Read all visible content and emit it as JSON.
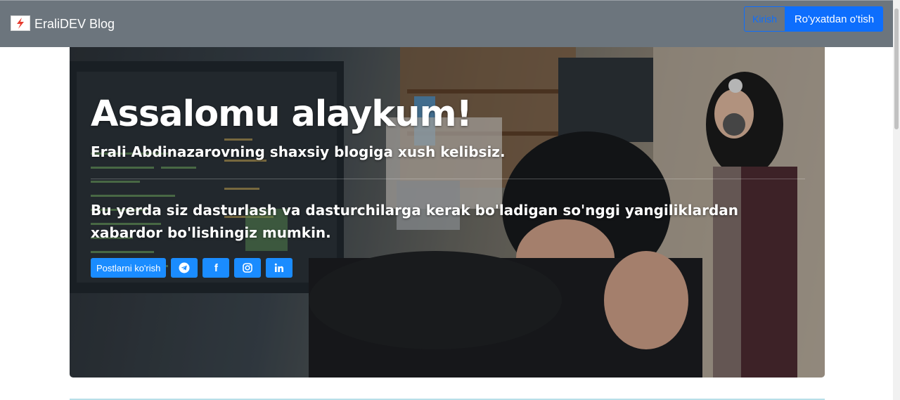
{
  "navbar": {
    "brand_text": "EraliDEV Blog",
    "login_label": "Kirish",
    "register_label": "Ro'yxatdan o'tish"
  },
  "hero": {
    "title": "Assalomu alaykum!",
    "subtitle": "Erali Abdinazarovning shaxsiy blogiga xush kelibsiz.",
    "description": "Bu yerda siz dasturlash va dasturchilarga kerak bo'ladigan so'nggi yangiliklardan xabardor bo'lishingiz mumkin.",
    "posts_button": "Postlarni ko'rish",
    "social": [
      "telegram-icon",
      "facebook-icon",
      "instagram-icon",
      "linkedin-icon"
    ]
  },
  "colors": {
    "navbar_bg": "#6c757d",
    "primary": "#0d6efd",
    "button_bg": "#1a8cff",
    "logo_accent": "#e63b2e"
  }
}
